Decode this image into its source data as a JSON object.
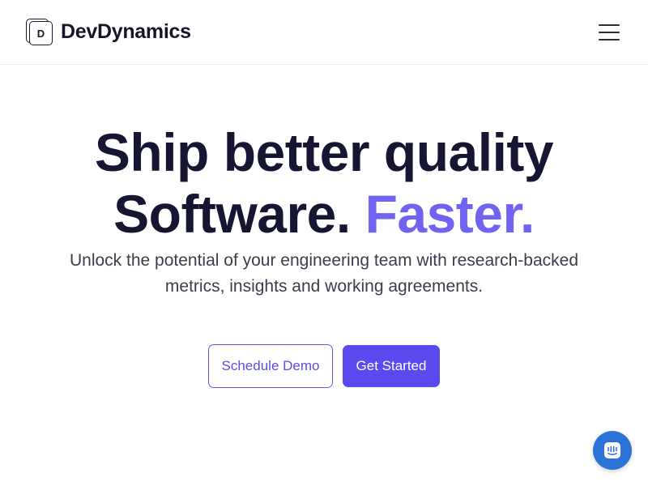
{
  "header": {
    "logo_letter": "D",
    "brand_name": "DevDynamics",
    "menu_icon": "hamburger-menu-icon"
  },
  "hero": {
    "headline_line1": "Ship better quality",
    "headline_line2_plain": "Software.",
    "headline_line2_accent": "Faster.",
    "subtitle": "Unlock the potential of your engineering team with research-backed metrics, insights and working agreements."
  },
  "cta": {
    "secondary_label": "Schedule Demo",
    "primary_label": "Get Started"
  },
  "chat": {
    "icon": "chat-bubble-icon"
  },
  "colors": {
    "accent": "#7163f2",
    "primary_button": "#5a4af0",
    "chat_launcher": "#2d73d6"
  }
}
